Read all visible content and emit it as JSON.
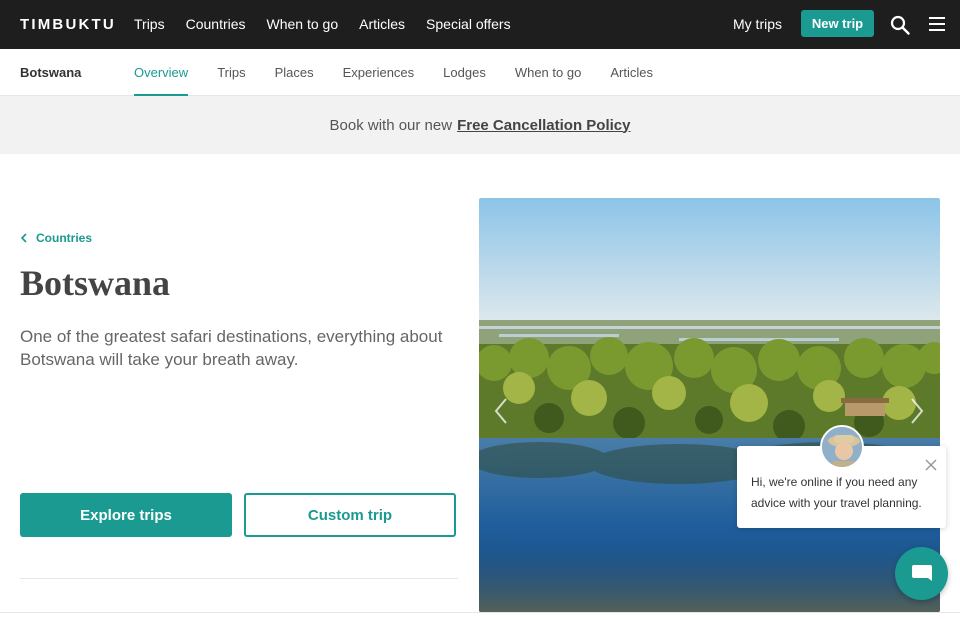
{
  "topnav": {
    "logo": "TIMBUKTU",
    "links": [
      "Trips",
      "Countries",
      "When to go",
      "Articles",
      "Special offers"
    ],
    "my_trips": "My trips",
    "new_trip": "New trip"
  },
  "subnav": {
    "country": "Botswana",
    "tabs": [
      "Overview",
      "Trips",
      "Places",
      "Experiences",
      "Lodges",
      "When to go",
      "Articles"
    ],
    "active_tab": "Overview"
  },
  "banner": {
    "text": "Book with our new",
    "link": "Free Cancellation Policy"
  },
  "main": {
    "back_label": "Countries",
    "title": "Botswana",
    "description": "One of the greatest safari destinations, everything about Botswana will take your breath away.",
    "primary_button": "Explore trips",
    "secondary_button": "Custom trip"
  },
  "chat": {
    "message": "Hi, we're online if you need any advice with your travel planning."
  },
  "colors": {
    "accent": "#1a9a90",
    "nav_bg": "#1e1e1e",
    "banner_bg": "#f2f2f2"
  },
  "icons": [
    "search-icon",
    "menu-icon",
    "chevron-left-icon",
    "chevron-right-icon",
    "close-icon",
    "chat-icon"
  ]
}
